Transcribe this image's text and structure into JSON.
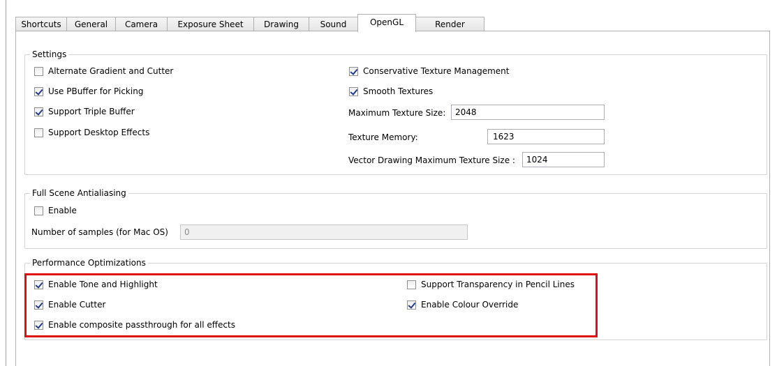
{
  "tabs": [
    {
      "label": "Shortcuts",
      "active": false
    },
    {
      "label": "General",
      "active": false
    },
    {
      "label": "Camera",
      "active": false
    },
    {
      "label": "Exposure Sheet",
      "active": false
    },
    {
      "label": "Drawing",
      "active": false
    },
    {
      "label": "Sound",
      "active": false
    },
    {
      "label": "OpenGL",
      "active": true
    },
    {
      "label": "Render",
      "active": false
    }
  ],
  "settings": {
    "title": "Settings",
    "alternate_gradient": {
      "label": "Alternate Gradient and Cutter",
      "checked": false
    },
    "use_pbuffer": {
      "label": "Use PBuffer for Picking",
      "checked": true
    },
    "triple_buffer": {
      "label": "Support Triple Buffer",
      "checked": true
    },
    "desktop_effects": {
      "label": "Support Desktop Effects",
      "checked": false
    },
    "conservative_texture": {
      "label": "Conservative Texture Management",
      "checked": true
    },
    "smooth_textures": {
      "label": "Smooth Textures",
      "checked": true
    },
    "max_texture_size": {
      "label": "Maximum Texture Size:",
      "value": "2048"
    },
    "texture_memory": {
      "label": "Texture Memory:",
      "value": "1623"
    },
    "vector_max_texture": {
      "label": "Vector Drawing Maximum Texture Size :",
      "value": "1024"
    }
  },
  "antialiasing": {
    "title": "Full Scene Antialiasing",
    "enable": {
      "label": "Enable",
      "checked": false
    },
    "samples": {
      "label": "Number of samples (for Mac OS)",
      "value": "0"
    }
  },
  "performance": {
    "title": "Performance Optimizations",
    "tone_highlight": {
      "label": "Enable Tone and Highlight",
      "checked": true
    },
    "cutter": {
      "label": "Enable Cutter",
      "checked": true
    },
    "composite_passthrough": {
      "label": "Enable composite passthrough for all effects",
      "checked": true
    },
    "pencil_transparency": {
      "label": "Support Transparency in Pencil Lines",
      "checked": false
    },
    "colour_override": {
      "label": "Enable Colour Override",
      "checked": true
    }
  },
  "colors": {
    "highlight_border": "#e01010",
    "check_mark": "#1f3a8f"
  }
}
